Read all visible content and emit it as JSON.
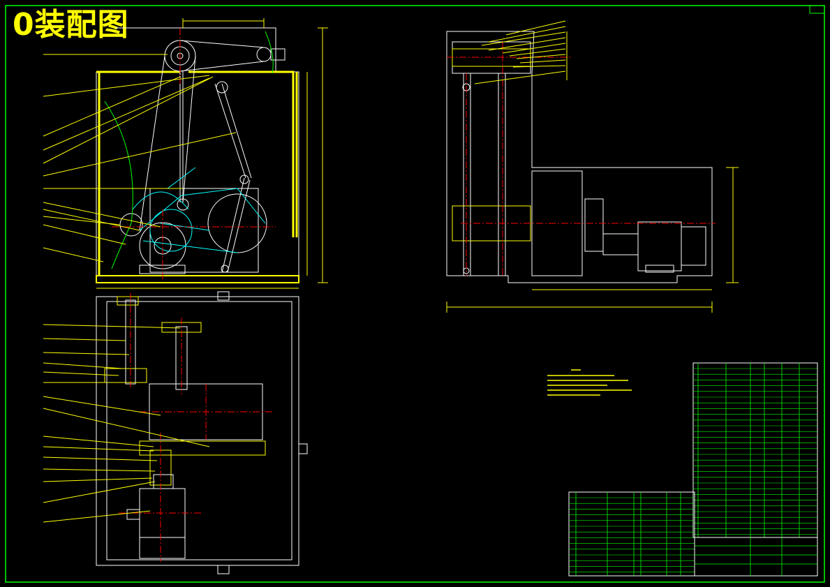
{
  "drawing": {
    "title": "0装配图",
    "colors": {
      "background": "#000000",
      "frame": "#00ff00",
      "outline": "#ffffff",
      "leader": "#ffff00",
      "centerline": "#ff0000",
      "hidden": "#00ffff",
      "hatch": "#ffff00"
    }
  }
}
